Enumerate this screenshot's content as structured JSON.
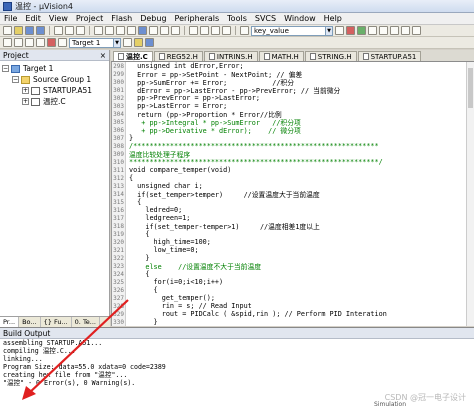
{
  "window": {
    "title": "温控 - µVision4"
  },
  "menu": [
    "File",
    "Edit",
    "View",
    "Project",
    "Flash",
    "Debug",
    "Peripherals",
    "Tools",
    "SVCS",
    "Window",
    "Help"
  ],
  "toolbar": {
    "find_combo_value": "key_value",
    "target_combo_value": "Target 1"
  },
  "project_panel": {
    "title": "Project",
    "tree": [
      {
        "label": "Target 1",
        "level": 0,
        "twist": "−",
        "icon": "target"
      },
      {
        "label": "Source Group 1",
        "level": 1,
        "twist": "−",
        "icon": "folder"
      },
      {
        "label": "STARTUP.A51",
        "level": 2,
        "twist": "+",
        "icon": "file"
      },
      {
        "label": "温控.C",
        "level": 2,
        "twist": "+",
        "icon": "file"
      }
    ],
    "tabs": [
      "Pr...",
      "Bo...",
      "{} Fu...",
      "0. Te..."
    ]
  },
  "editor_tabs": [
    {
      "label": "温控.C",
      "active": true
    },
    {
      "label": "REG52.H",
      "active": false
    },
    {
      "label": "INTRINS.H",
      "active": false
    },
    {
      "label": "MATH.H",
      "active": false
    },
    {
      "label": "STRING.H",
      "active": false
    },
    {
      "label": "STARTUP.A51",
      "active": false
    }
  ],
  "code_lines": [
    {
      "n": "298",
      "t": "  unsigned int dError,Error;"
    },
    {
      "n": "299",
      "t": "  Error = pp->SetPoint - NextPoint; // 偏差"
    },
    {
      "n": "300",
      "t": "  pp->SumError += Error;           //积分"
    },
    {
      "n": "301",
      "t": "  dError = pp->LastError - pp->PrevError; // 当前微分"
    },
    {
      "n": "302",
      "t": "  pp->PrevError = pp->LastError;"
    },
    {
      "n": "303",
      "t": "  pp->LastError = Error;"
    },
    {
      "n": "304",
      "t": "  return (pp->Proportion * Error//比例"
    },
    {
      "n": "305",
      "t": "   + pp->Integral * pp->SumError   //积分项"
    },
    {
      "n": "306",
      "t": "   + pp->Derivative * dError);    // 微分项"
    },
    {
      "n": "307",
      "t": "}"
    },
    {
      "n": "308",
      "t": "/************************************************************"
    },
    {
      "n": "309",
      "t": "温度比较处理子程序"
    },
    {
      "n": "310",
      "t": "*************************************************************/"
    },
    {
      "n": "311",
      "t": "void compare_temper(void)"
    },
    {
      "n": "312",
      "t": "{"
    },
    {
      "n": "313",
      "t": "  unsigned char i;"
    },
    {
      "n": "314",
      "t": "  if(set_temper>temper)     //设置温度大于当前温度"
    },
    {
      "n": "315",
      "t": "  {"
    },
    {
      "n": "316",
      "t": "    ledred=0;"
    },
    {
      "n": "317",
      "t": "    ledgreen=1;"
    },
    {
      "n": "318",
      "t": "    if(set_temper-temper>1)     //温度相差1度以上"
    },
    {
      "n": "319",
      "t": "    {"
    },
    {
      "n": "320",
      "t": "      high_time=100;"
    },
    {
      "n": "321",
      "t": "      low_time=0;"
    },
    {
      "n": "322",
      "t": "    }"
    },
    {
      "n": "323",
      "t": "    else    //设置温度不大于当前温度"
    },
    {
      "n": "324",
      "t": "    {"
    },
    {
      "n": "325",
      "t": "      for(i=0;i<10;i++)"
    },
    {
      "n": "326",
      "t": "      {"
    },
    {
      "n": "327",
      "t": "        get_temper();"
    },
    {
      "n": "328",
      "t": "        rin = s; // Read Input"
    },
    {
      "n": "329",
      "t": "        rout = PIDCalc ( &spid,rin ); // Perform PID Interation"
    },
    {
      "n": "330",
      "t": "      }"
    }
  ],
  "build_output": {
    "title": "Build Output",
    "lines": [
      "assembling STARTUP.A51...",
      "compiling 温控.C...",
      "linking...",
      "Program Size: data=55.0 xdata=0 code=2389",
      "creating hex file from \"温控\"...",
      "\"温控\" - 0 Error(s), 0 Warning(s)."
    ]
  },
  "status_text": "Simulation",
  "watermark": "CSDN @冠一电子设计",
  "colors": {
    "comment": "#008000",
    "arrow": "#e02020"
  }
}
